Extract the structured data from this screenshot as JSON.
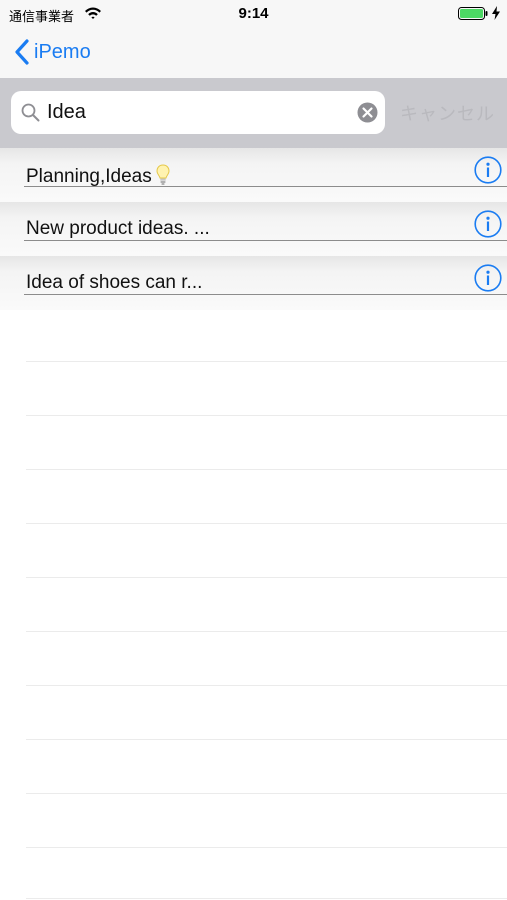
{
  "status_bar": {
    "carrier": "通信事業者",
    "time": "9:14"
  },
  "nav": {
    "back_label": "iPemo"
  },
  "search": {
    "value": "Idea",
    "cancel_label": "キャンセル"
  },
  "results": [
    {
      "title": "Planning,Ideas",
      "has_bulb": true
    },
    {
      "title": "New product ideas. ...",
      "has_bulb": false
    },
    {
      "title": "Idea of shoes can r...",
      "has_bulb": false
    }
  ],
  "colors": {
    "accent": "#1a7cf2",
    "search_bar_bg": "#c9c9ce",
    "cancel_text": "#b9b9be",
    "battery": "#4cd964"
  },
  "icons": {
    "wifi": "wifi-icon",
    "battery": "battery-icon",
    "back": "chevron-left-icon",
    "search": "search-icon",
    "clear": "clear-circle-icon",
    "info": "info-icon",
    "bulb": "lightbulb-icon"
  }
}
